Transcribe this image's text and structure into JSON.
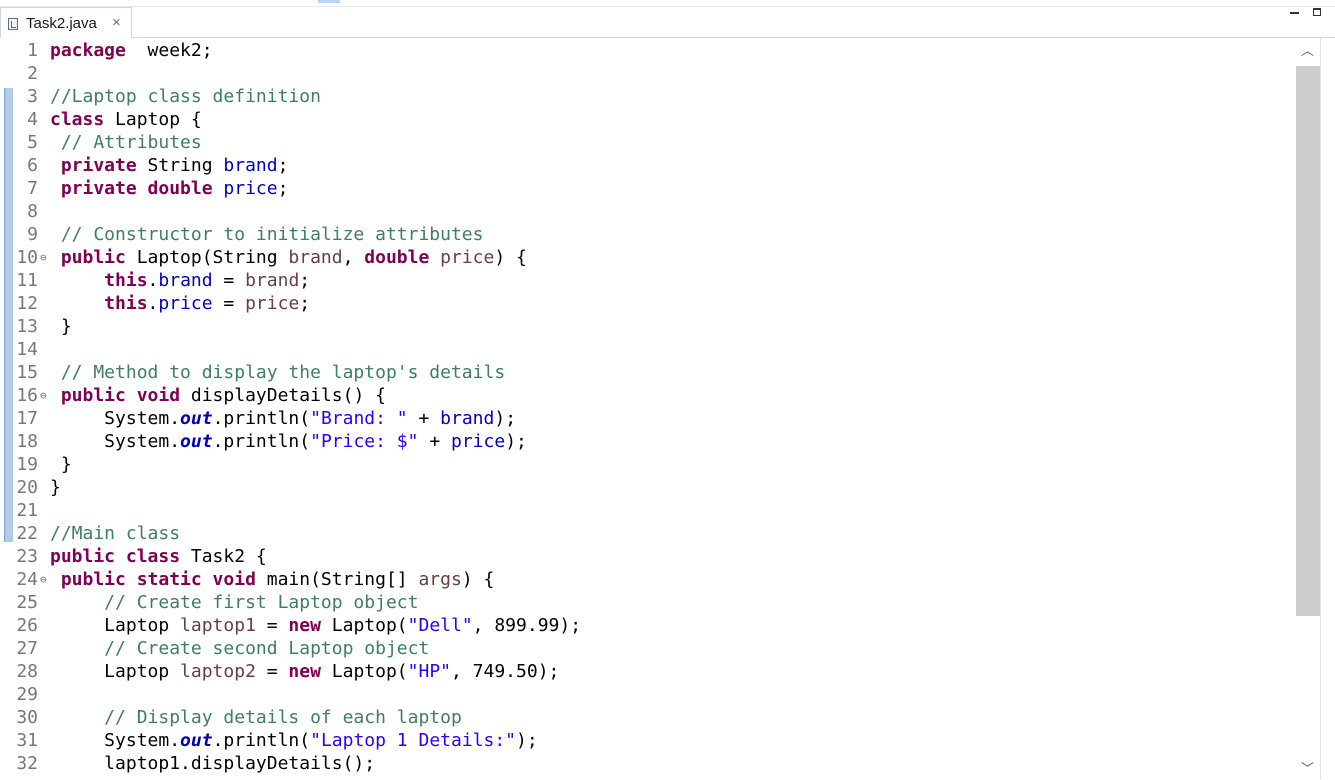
{
  "tab": {
    "title": "Task2.java",
    "close_glyph": "×",
    "icon": "java-file-icon"
  },
  "window_controls": {
    "minimize_icon": "minimize-icon",
    "maximize_icon": "maximize-icon"
  },
  "scrollbar": {
    "up_glyph": "︿",
    "down_glyph": "﹀",
    "position_fraction": 0.0,
    "visible_fraction": 0.72
  },
  "colors": {
    "keyword": "#7f0055",
    "comment": "#3f7f5f",
    "field": "#0000c0",
    "string": "#2a00ff",
    "parameter": "#6a3e3e",
    "line_number": "#787878"
  },
  "code_lines": [
    {
      "n": "1",
      "fold": "",
      "tokens": [
        [
          "kw",
          "package"
        ],
        [
          "",
          "  week2;"
        ]
      ]
    },
    {
      "n": "2",
      "fold": "",
      "tokens": []
    },
    {
      "n": "3",
      "fold": "",
      "tokens": [
        [
          "cm",
          "//Laptop class definition"
        ]
      ]
    },
    {
      "n": "4",
      "fold": "",
      "tokens": [
        [
          "kw",
          "class"
        ],
        [
          "",
          " Laptop {"
        ]
      ]
    },
    {
      "n": "5",
      "fold": "",
      "tokens": [
        [
          "cm",
          " // Attributes"
        ]
      ]
    },
    {
      "n": "6",
      "fold": "",
      "tokens": [
        [
          "kw",
          " private"
        ],
        [
          "",
          " String "
        ],
        [
          "fd",
          "brand"
        ],
        [
          "",
          ";"
        ]
      ]
    },
    {
      "n": "7",
      "fold": "",
      "tokens": [
        [
          "kw",
          " private double"
        ],
        [
          "",
          " "
        ],
        [
          "fd",
          "price"
        ],
        [
          "",
          ";"
        ]
      ]
    },
    {
      "n": "8",
      "fold": "",
      "tokens": []
    },
    {
      "n": "9",
      "fold": "",
      "tokens": [
        [
          "cm",
          " // Constructor to initialize attributes"
        ]
      ]
    },
    {
      "n": "10",
      "fold": "⊖",
      "tokens": [
        [
          "kw",
          " public"
        ],
        [
          "",
          " Laptop(String "
        ],
        [
          "pm",
          "brand"
        ],
        [
          "",
          ", "
        ],
        [
          "kw",
          "double"
        ],
        [
          "",
          " "
        ],
        [
          "pm",
          "price"
        ],
        [
          "",
          ") {"
        ]
      ]
    },
    {
      "n": "11",
      "fold": "",
      "tokens": [
        [
          "kw",
          "     this"
        ],
        [
          "",
          "."
        ],
        [
          "fd",
          "brand"
        ],
        [
          "",
          " = "
        ],
        [
          "pm",
          "brand"
        ],
        [
          "",
          ";"
        ]
      ]
    },
    {
      "n": "12",
      "fold": "",
      "tokens": [
        [
          "kw",
          "     this"
        ],
        [
          "",
          "."
        ],
        [
          "fd",
          "price"
        ],
        [
          "",
          " = "
        ],
        [
          "pm",
          "price"
        ],
        [
          "",
          ";"
        ]
      ]
    },
    {
      "n": "13",
      "fold": "",
      "tokens": [
        [
          "",
          " }"
        ]
      ]
    },
    {
      "n": "14",
      "fold": "",
      "tokens": []
    },
    {
      "n": "15",
      "fold": "",
      "tokens": [
        [
          "cm",
          " // Method to display the laptop's details"
        ]
      ]
    },
    {
      "n": "16",
      "fold": "⊖",
      "tokens": [
        [
          "kw",
          " public void"
        ],
        [
          "",
          " displayDetails() {"
        ]
      ]
    },
    {
      "n": "17",
      "fold": "",
      "tokens": [
        [
          "",
          "     System."
        ],
        [
          "sf",
          "out"
        ],
        [
          "",
          ".println("
        ],
        [
          "st",
          "\"Brand: \""
        ],
        [
          "",
          " + "
        ],
        [
          "fd",
          "brand"
        ],
        [
          "",
          ");"
        ]
      ]
    },
    {
      "n": "18",
      "fold": "",
      "tokens": [
        [
          "",
          "     System."
        ],
        [
          "sf",
          "out"
        ],
        [
          "",
          ".println("
        ],
        [
          "st",
          "\"Price: $\""
        ],
        [
          "",
          " + "
        ],
        [
          "fd",
          "price"
        ],
        [
          "",
          ");"
        ]
      ]
    },
    {
      "n": "19",
      "fold": "",
      "tokens": [
        [
          "",
          " }"
        ]
      ]
    },
    {
      "n": "20",
      "fold": "",
      "tokens": [
        [
          "",
          "}"
        ]
      ]
    },
    {
      "n": "21",
      "fold": "",
      "tokens": []
    },
    {
      "n": "22",
      "fold": "",
      "tokens": [
        [
          "cm",
          "//Main class"
        ]
      ]
    },
    {
      "n": "23",
      "fold": "",
      "tokens": [
        [
          "kw",
          "public class"
        ],
        [
          "",
          " Task2 {"
        ]
      ]
    },
    {
      "n": "24",
      "fold": "⊖",
      "tokens": [
        [
          "kw",
          " public static void"
        ],
        [
          "",
          " main(String[] "
        ],
        [
          "pm",
          "args"
        ],
        [
          "",
          ") {"
        ]
      ]
    },
    {
      "n": "25",
      "fold": "",
      "tokens": [
        [
          "cm",
          "     // Create first Laptop object"
        ]
      ]
    },
    {
      "n": "26",
      "fold": "",
      "tokens": [
        [
          "",
          "     Laptop "
        ],
        [
          "pm",
          "laptop1"
        ],
        [
          "",
          " = "
        ],
        [
          "kw",
          "new"
        ],
        [
          "",
          " Laptop("
        ],
        [
          "st",
          "\"Dell\""
        ],
        [
          "",
          ", 899.99);"
        ]
      ]
    },
    {
      "n": "27",
      "fold": "",
      "tokens": [
        [
          "cm",
          "     // Create second Laptop object"
        ]
      ]
    },
    {
      "n": "28",
      "fold": "",
      "tokens": [
        [
          "",
          "     Laptop "
        ],
        [
          "pm",
          "laptop2"
        ],
        [
          "",
          " = "
        ],
        [
          "kw",
          "new"
        ],
        [
          "",
          " Laptop("
        ],
        [
          "st",
          "\"HP\""
        ],
        [
          "",
          ", 749.50);"
        ]
      ]
    },
    {
      "n": "29",
      "fold": "",
      "tokens": []
    },
    {
      "n": "30",
      "fold": "",
      "tokens": [
        [
          "cm",
          "     // Display details of each laptop"
        ]
      ]
    },
    {
      "n": "31",
      "fold": "",
      "tokens": [
        [
          "",
          "     System."
        ],
        [
          "sf",
          "out"
        ],
        [
          "",
          ".println("
        ],
        [
          "st",
          "\"Laptop 1 Details:\""
        ],
        [
          "",
          ");"
        ]
      ]
    },
    {
      "n": "32",
      "fold": "",
      "tokens": [
        [
          "",
          "     laptop1.displayDetails();"
        ]
      ]
    }
  ]
}
